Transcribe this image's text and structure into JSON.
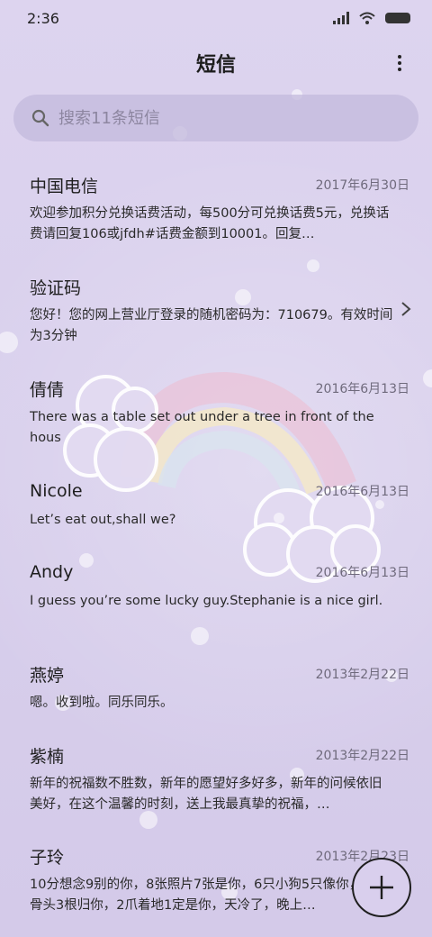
{
  "status": {
    "time": "2:36"
  },
  "header": {
    "title": "短信"
  },
  "search": {
    "placeholder": "搜索11条短信"
  },
  "messages": [
    {
      "sender": "中国电信",
      "date": "2017年6月30日",
      "preview": "欢迎参加积分兑换话费活动，每500分可兑换话费5元，兑换话费请回复106或jfdh#话费金额到10001。回复…"
    },
    {
      "sender": "验证码",
      "date": "",
      "preview": "您好！您的网上营业厅登录的随机密码为：710679。有效时间为3分钟"
    },
    {
      "sender": "倩倩",
      "date": "2016年6月13日",
      "preview": "There was a table set out under a tree in front of the hous"
    },
    {
      "sender": "Nicole",
      "date": "2016年6月13日",
      "preview": "Let’s eat out,shall we?"
    },
    {
      "sender": "Andy",
      "date": "2016年6月13日",
      "preview": "I guess you’re some lucky guy.Stephanie is a nice girl."
    },
    {
      "sender": "燕婷",
      "date": "2013年2月22日",
      "preview": "嗯。收到啦。同乐同乐。"
    },
    {
      "sender": "紫楠",
      "date": "2013年2月22日",
      "preview": "新年的祝福数不胜数，新年的愿望好多好多，新年的问候依旧美好，在这个温馨的时刻，送上我最真挚的祝福，…"
    },
    {
      "sender": "子玲",
      "date": "2013年2月23日",
      "preview": "10分想念9别的你，8张照片7张是你，6只小狗5只像你，4根骨头3根归你，2爪着地1定是你，天冷了，晚上…"
    }
  ],
  "icons": {
    "signal": "signal-icon",
    "wifi": "wifi-icon",
    "battery": "battery-icon",
    "more": "more-vertical-icon",
    "search": "search-icon",
    "chevron": "chevron-right-icon",
    "compose": "plus-icon"
  },
  "colors": {
    "background": "#dcd3ee",
    "search_bg": "#c3b9dc",
    "text": "#1e1e1e",
    "date": "#6f6a7c"
  }
}
